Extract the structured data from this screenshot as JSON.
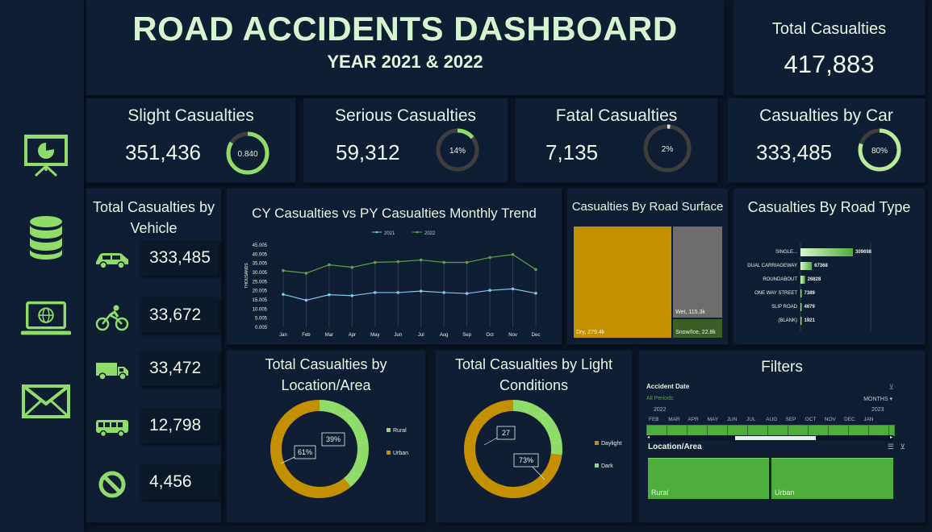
{
  "header": {
    "title": "ROAD ACCIDENTS DASHBOARD",
    "subtitle": "YEAR 2021 & 2022"
  },
  "total": {
    "label": "Total Casualties",
    "value": "417,883"
  },
  "kpis": [
    {
      "label": "Slight Casualties",
      "value": "351,436",
      "donut_label": "0.840",
      "fraction": 0.84
    },
    {
      "label": "Serious Casualties",
      "value": "59,312",
      "donut_label": "14%",
      "fraction": 0.14
    },
    {
      "label": "Fatal Casualties",
      "value": "7,135",
      "donut_label": "2%",
      "fraction": 0.02
    },
    {
      "label": "Casualties by Car",
      "value": "333,485",
      "donut_label": "80%",
      "fraction": 0.8
    }
  ],
  "sidebar": {
    "icons": [
      "presentation-icon",
      "database-icon",
      "laptop-globe-icon",
      "mail-icon"
    ]
  },
  "vehicle": {
    "title": "Total Casualties by Vehicle",
    "items": [
      {
        "icon": "car-icon",
        "value": "333,485"
      },
      {
        "icon": "bicycle-icon",
        "value": "33,672"
      },
      {
        "icon": "truck-icon",
        "value": "33,472"
      },
      {
        "icon": "bus-icon",
        "value": "12,798"
      },
      {
        "icon": "no-entry-icon",
        "value": "4,456"
      }
    ]
  },
  "trend": {
    "title": "CY Casualties vs PY Casualties Monthly Trend",
    "yunit": "THOUSANDS",
    "chart_data": {
      "type": "line",
      "x": [
        "Jan",
        "Feb",
        "Mar",
        "Apr",
        "May",
        "Jun",
        "Jul",
        "Aug",
        "Sep",
        "Oct",
        "Nov",
        "Dec"
      ],
      "series": [
        {
          "name": "2021",
          "color": "#7fc6ef",
          "values": [
            18.0,
            14.8,
            17.8,
            17.3,
            19.0,
            19.0,
            19.8,
            19.0,
            18.5,
            20.2,
            21.0,
            18.6
          ]
        },
        {
          "name": "2022",
          "color": "#5fa04a",
          "values": [
            31.0,
            29.6,
            34.2,
            32.8,
            35.5,
            35.9,
            36.8,
            35.5,
            35.5,
            38.2,
            39.8,
            31.6
          ]
        }
      ],
      "yticks": [
        "45.005",
        "40.005",
        "35.005",
        "30.005",
        "25.005",
        "20.005",
        "15.005",
        "10.005",
        "5.005",
        "0.005"
      ],
      "ylim": [
        0,
        45
      ]
    }
  },
  "surface": {
    "title": "Casualties By Road Surface",
    "chart_data": {
      "type": "treemap",
      "items": [
        {
          "label": "Dry, 279.4k",
          "value": 279.4,
          "color": "#c49000"
        },
        {
          "label": "Wet, 115.3k",
          "value": 115.3,
          "color": "#6e6c6c"
        },
        {
          "label": "Snow/Ice, 22.8k",
          "value": 22.8,
          "color": "#3c5f2a"
        }
      ]
    }
  },
  "roadtype": {
    "title": "Casualties By Road Type",
    "chart_data": {
      "type": "bar",
      "categories": [
        "SINGLE...",
        "DUAL CARRIAGEWAY",
        "ROUNDABOUT",
        "ONE WAY STREET",
        "SLIP ROAD",
        "(BLANK)"
      ],
      "values": [
        309698,
        67368,
        26828,
        7389,
        4679,
        1921
      ],
      "labels": [
        "309698",
        "67368",
        "26828",
        "7389",
        "4679",
        "1921"
      ]
    }
  },
  "location": {
    "title": "Total Casualties by Location/Area",
    "chart_data": {
      "type": "pie",
      "labels": [
        "Rural",
        "Urban"
      ],
      "values": [
        39,
        61
      ],
      "data_labels": [
        "39%",
        "61%"
      ],
      "colors": [
        "#8fdc6a",
        "#c49000"
      ]
    }
  },
  "light": {
    "title": "Total Casualties by Light Conditions",
    "chart_data": {
      "type": "pie",
      "labels": [
        "Daylight",
        "Dark"
      ],
      "values": [
        73,
        27
      ],
      "data_labels": [
        "73%",
        "27"
      ],
      "colors": [
        "#c49000",
        "#8fdc6a"
      ]
    }
  },
  "filters": {
    "title": "Filters",
    "timeline": {
      "label": "Accident Date",
      "period": "All Periods",
      "unit": "MONTHS",
      "year_start": "2022",
      "year_end": "2023",
      "months": [
        "FEB",
        "MAR",
        "APR",
        "MAY",
        "JUN",
        "JUL",
        "AUG",
        "SEP",
        "OCT",
        "NOV",
        "DEC",
        "JAN"
      ]
    },
    "slicer": {
      "label": "Location/Area",
      "options": [
        "Rural",
        "Urban"
      ]
    }
  }
}
